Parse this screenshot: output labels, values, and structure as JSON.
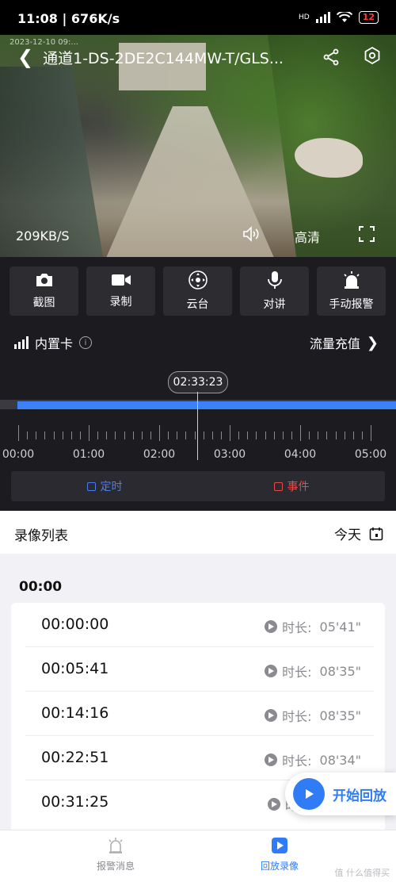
{
  "status_bar": {
    "time": "11:08",
    "speed": "676K/s",
    "hd": "HD",
    "battery": "12"
  },
  "video": {
    "overlay_timestamp": "2023-12-10 09:...",
    "title": "通道1-DS-2DE2C144MW-T/GLS...",
    "bitrate": "209KB/S",
    "quality": "高清"
  },
  "toolbar": {
    "items": [
      {
        "label": "截图",
        "icon": "camera-icon"
      },
      {
        "label": "录制",
        "icon": "video-record-icon"
      },
      {
        "label": "云台",
        "icon": "ptz-icon"
      },
      {
        "label": "对讲",
        "icon": "microphone-icon"
      },
      {
        "label": "手动报警",
        "icon": "alarm-icon"
      }
    ]
  },
  "sim": {
    "label": "内置卡",
    "info": "i",
    "recharge": "流量充值"
  },
  "timeline": {
    "current_time": "02:33:23",
    "labels": [
      "00:00",
      "01:00",
      "02:00",
      "03:00",
      "04:00",
      "05:00"
    ],
    "filters": [
      {
        "label": "定时",
        "color": "#4a7cf0"
      },
      {
        "label": "事件",
        "color": "#e84a4a"
      }
    ]
  },
  "list": {
    "title": "录像列表",
    "date_label": "今天",
    "hour_group": "00:00",
    "duration_prefix": "时长:",
    "records": [
      {
        "time": "00:00:00",
        "duration": "05'41\""
      },
      {
        "time": "00:05:41",
        "duration": "08'35\""
      },
      {
        "time": "00:14:16",
        "duration": "08'35\""
      },
      {
        "time": "00:22:51",
        "duration": "08'34\""
      },
      {
        "time": "00:31:25",
        "duration": ""
      }
    ],
    "play_button": "开始回放",
    "partial_prefix": "时"
  },
  "bottom_nav": {
    "items": [
      {
        "label": "报警消息",
        "icon": "alarm-message-icon",
        "active": false
      },
      {
        "label": "回放录像",
        "icon": "playback-icon",
        "active": true
      }
    ]
  },
  "watermark": "值 什么值得买",
  "colors": {
    "accent": "#2f7cf6",
    "panel": "#1c1c20",
    "timeline": "#3b82f6"
  }
}
